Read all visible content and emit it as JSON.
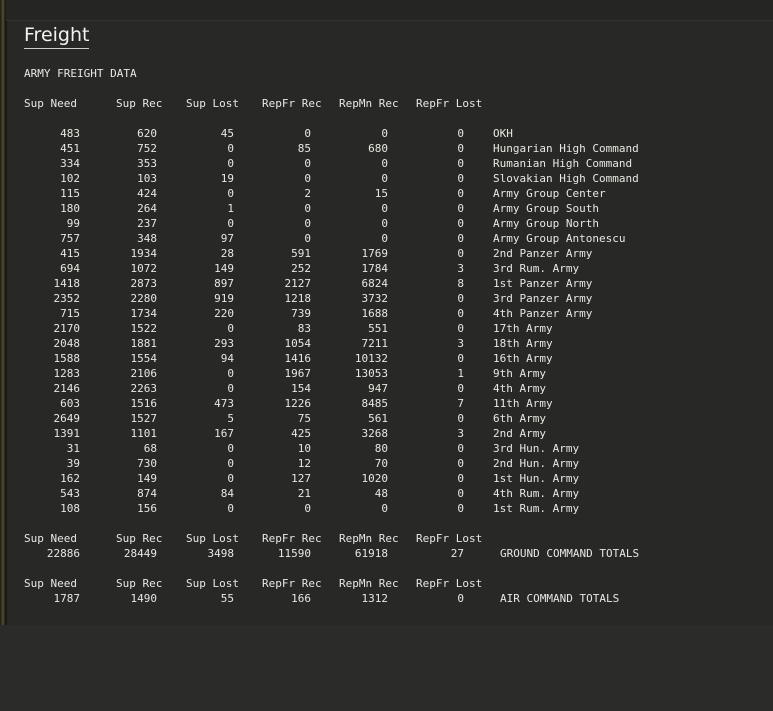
{
  "title": "Freight",
  "subtitle": "ARMY FREIGHT DATA",
  "headers": [
    "Sup Need",
    "Sup Rec",
    "Sup Lost",
    "RepFr Rec",
    "RepMn Rec",
    "RepFr Lost"
  ],
  "rows": [
    [
      "483",
      "620",
      "45",
      "0",
      "0",
      "0",
      "OKH"
    ],
    [
      "451",
      "752",
      "0",
      "85",
      "680",
      "0",
      "Hungarian High Command"
    ],
    [
      "334",
      "353",
      "0",
      "0",
      "0",
      "0",
      "Rumanian High Command"
    ],
    [
      "102",
      "103",
      "19",
      "0",
      "0",
      "0",
      "Slovakian High Command"
    ],
    [
      "115",
      "424",
      "0",
      "2",
      "15",
      "0",
      "Army Group Center"
    ],
    [
      "180",
      "264",
      "1",
      "0",
      "0",
      "0",
      "Army Group South"
    ],
    [
      "99",
      "237",
      "0",
      "0",
      "0",
      "0",
      "Army Group North"
    ],
    [
      "757",
      "348",
      "97",
      "0",
      "0",
      "0",
      "Army Group Antonescu"
    ],
    [
      "415",
      "1934",
      "28",
      "591",
      "1769",
      "0",
      "2nd Panzer Army"
    ],
    [
      "694",
      "1072",
      "149",
      "252",
      "1784",
      "3",
      "3rd Rum. Army"
    ],
    [
      "1418",
      "2873",
      "897",
      "2127",
      "6824",
      "8",
      "1st Panzer Army"
    ],
    [
      "2352",
      "2280",
      "919",
      "1218",
      "3732",
      "0",
      "3rd Panzer Army"
    ],
    [
      "715",
      "1734",
      "220",
      "739",
      "1688",
      "0",
      "4th Panzer Army"
    ],
    [
      "2170",
      "1522",
      "0",
      "83",
      "551",
      "0",
      "17th Army"
    ],
    [
      "2048",
      "1881",
      "293",
      "1054",
      "7211",
      "3",
      "18th Army"
    ],
    [
      "1588",
      "1554",
      "94",
      "1416",
      "10132",
      "0",
      "16th Army"
    ],
    [
      "1283",
      "2106",
      "0",
      "1967",
      "13053",
      "1",
      "9th Army"
    ],
    [
      "2146",
      "2263",
      "0",
      "154",
      "947",
      "0",
      "4th Army"
    ],
    [
      "603",
      "1516",
      "473",
      "1226",
      "8485",
      "7",
      "11th Army"
    ],
    [
      "2649",
      "1527",
      "5",
      "75",
      "561",
      "0",
      "6th Army"
    ],
    [
      "1391",
      "1101",
      "167",
      "425",
      "3268",
      "3",
      "2nd Army"
    ],
    [
      "31",
      "68",
      "0",
      "10",
      "80",
      "0",
      "3rd Hun. Army"
    ],
    [
      "39",
      "730",
      "0",
      "12",
      "70",
      "0",
      "2nd Hun. Army"
    ],
    [
      "162",
      "149",
      "0",
      "127",
      "1020",
      "0",
      "1st Hun. Army"
    ],
    [
      "543",
      "874",
      "84",
      "21",
      "48",
      "0",
      "4th Rum. Army"
    ],
    [
      "108",
      "156",
      "0",
      "0",
      "0",
      "0",
      "1st Rum. Army"
    ]
  ],
  "ground_totals": {
    "headers": [
      "Sup Need",
      "Sup Rec",
      "Sup Lost",
      "RepFr Rec",
      "RepMn Rec",
      "RepFr Lost"
    ],
    "values": [
      "22886",
      "28449",
      "3498",
      "11590",
      "61918",
      "27"
    ],
    "label": "GROUND COMMAND TOTALS"
  },
  "air_totals": {
    "headers": [
      "Sup Need",
      "Sup Rec",
      "Sup Lost",
      "RepFr Rec",
      "RepMn Rec",
      "RepFr Lost"
    ],
    "values": [
      "1787",
      "1490",
      "55",
      "166",
      "1312",
      "0"
    ],
    "label": "AIR COMMAND TOTALS"
  }
}
